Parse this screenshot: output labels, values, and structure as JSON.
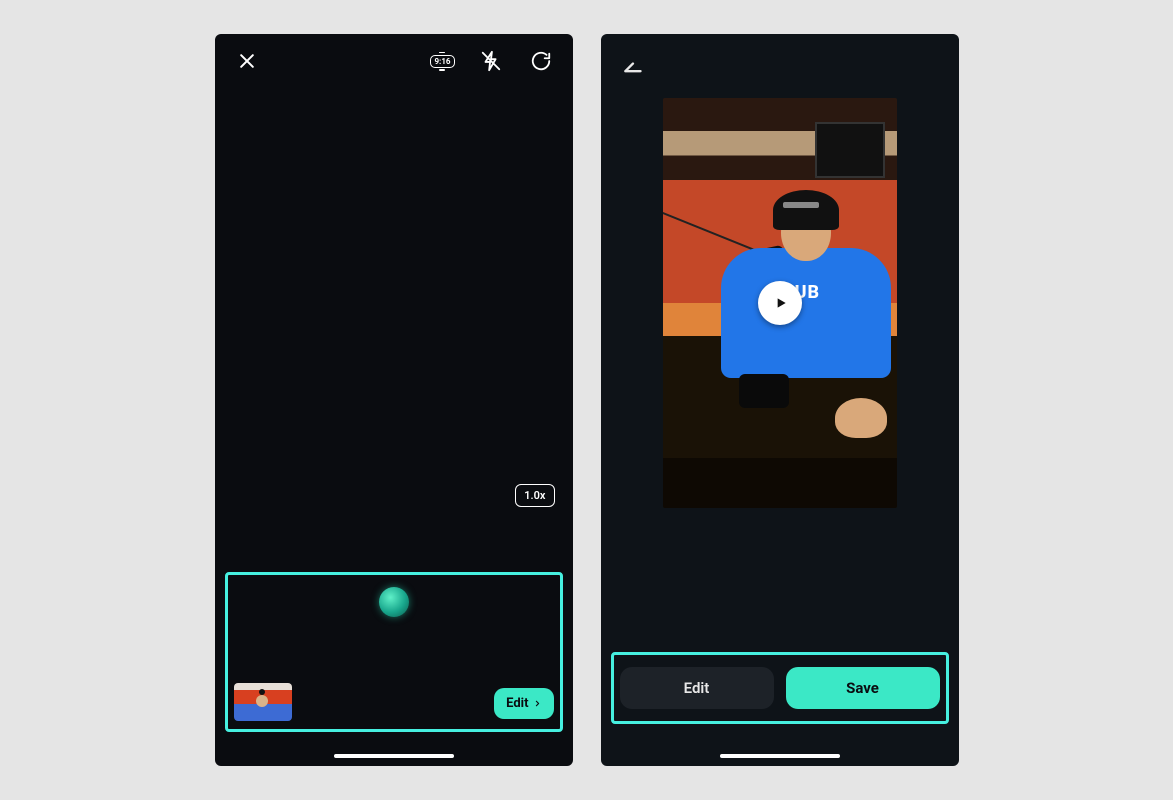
{
  "left_screen": {
    "aspect_ratio_label": "9:16",
    "zoom_label": "1.0x",
    "edit_button_label": "Edit"
  },
  "right_screen": {
    "edit_button_label": "Edit",
    "save_button_label": "Save"
  },
  "colors": {
    "highlight": "#46f0e0",
    "accent": "#3be8c6"
  }
}
